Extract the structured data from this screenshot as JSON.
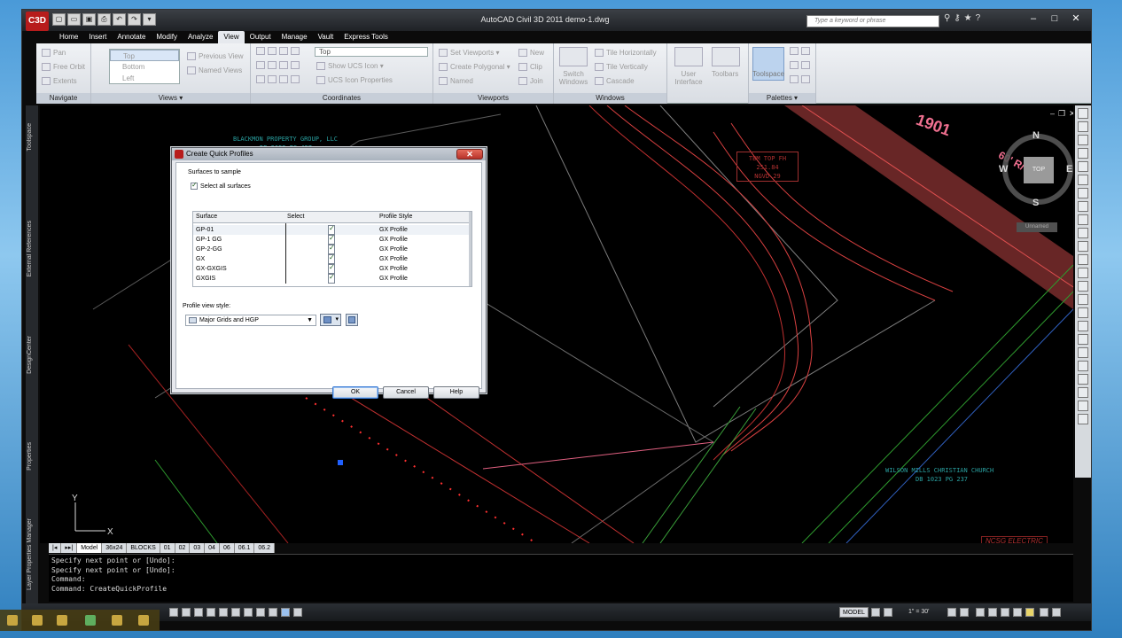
{
  "app": {
    "title": "AutoCAD Civil 3D 2011    demo-1.dwg",
    "logo": "C3D",
    "search_placeholder": "Type a keyword or phrase"
  },
  "menu_tabs": [
    "Home",
    "Insert",
    "Annotate",
    "Modify",
    "Analyze",
    "View",
    "Output",
    "Manage",
    "Vault",
    "Express Tools"
  ],
  "active_tab": "View",
  "ribbon": {
    "navigate": {
      "label": "Navigate",
      "items": [
        "Pan",
        "Free Orbit",
        "Extents"
      ]
    },
    "views": {
      "label": "Views",
      "list": [
        "Top",
        "Bottom",
        "Left"
      ],
      "items": [
        "Previous View",
        "Named Views"
      ]
    },
    "coordinates": {
      "label": "Coordinates",
      "ucs_value": "Top",
      "items": [
        "Show UCS Icon",
        "UCS Icon Properties"
      ]
    },
    "viewports": {
      "label": "Viewports",
      "items": [
        "Set Viewports",
        "Create Polygonal",
        "Named",
        "New",
        "Clip",
        "Join"
      ]
    },
    "windows": {
      "label": "Windows",
      "switch": "Switch Windows",
      "items": [
        "Tile Horizontally",
        "Tile Vertically",
        "Cascade"
      ]
    },
    "user_interface": {
      "label": "User Interface",
      "toolbars": "Toolbars"
    },
    "palettes": {
      "label": "Palettes",
      "toolspace": "Toolspace"
    }
  },
  "left_palette": [
    "Toolspace",
    "External References",
    "DesignCenter",
    "Properties",
    "Layer Properties Manager"
  ],
  "drawing_text": {
    "owner": "BLACKMON PROPERTY GROUP, LLC",
    "deed": "DB 3652 PG 457",
    "tbm_1": "TBM TOP FH",
    "tbm_2": "251.84",
    "tbm_3": "NGVD 29",
    "road_num": "1901",
    "road_rw": "60' R/W",
    "church": "WILSON MILLS CHRISTIAN CHURCH",
    "church_db": "DB 1023 PG 237",
    "ncsg": "NCSG ELECTRIC",
    "unnamed": "Unnamed"
  },
  "viewcube": {
    "N": "N",
    "S": "S",
    "E": "E",
    "W": "W",
    "top": "TOP"
  },
  "layout_tabs": [
    "Model",
    "36x24",
    "BLOCKS",
    "01",
    "02",
    "03",
    "04",
    "06",
    "06.1",
    "06.2"
  ],
  "command_lines": [
    "Specify next point or [Undo]:",
    "Specify next point or [Undo]:",
    "Command:",
    "Command: CreateQuickProfile"
  ],
  "statusbar": {
    "model": "MODEL",
    "scale": "1\" = 30'"
  },
  "dialog": {
    "title": "Create Quick Profiles",
    "surfaces_label": "Surfaces to sample",
    "select_all": "Select all surfaces",
    "columns": [
      "Surface",
      "Select",
      "Profile Style"
    ],
    "rows": [
      {
        "surface": "GP-01",
        "style": "GX Profile"
      },
      {
        "surface": "GP-1 GG",
        "style": "GX Profile"
      },
      {
        "surface": "GP-2-GG",
        "style": "GX Profile"
      },
      {
        "surface": "GX",
        "style": "GX Profile"
      },
      {
        "surface": "GX-GXGIS",
        "style": "GX Profile"
      },
      {
        "surface": "GXGIS",
        "style": "GX Profile"
      }
    ],
    "profile_view_style_label": "Profile view style:",
    "profile_view_style": "Major Grids and HGP",
    "ok": "OK",
    "cancel": "Cancel",
    "help": "Help"
  }
}
